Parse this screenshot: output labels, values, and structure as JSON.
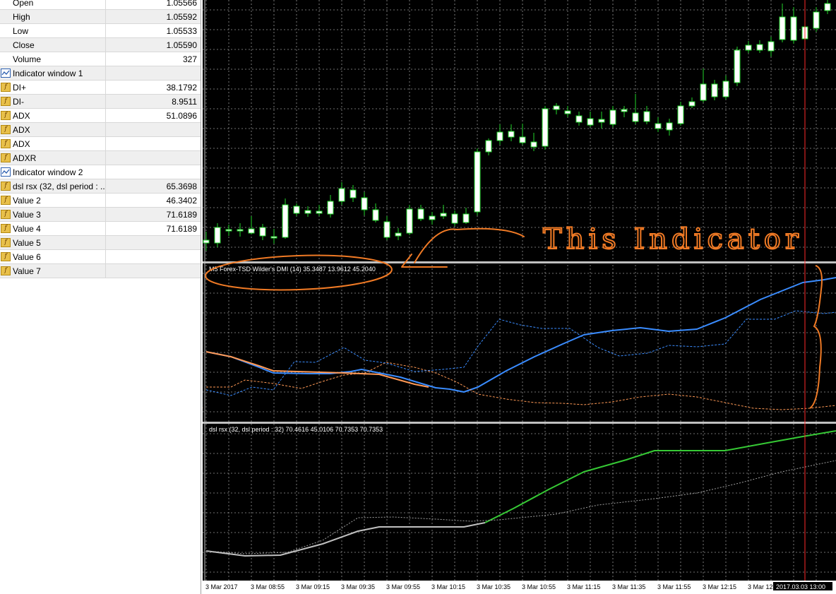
{
  "data_window": {
    "rows": [
      {
        "name": "Open",
        "value": "1.05566",
        "icon": "none",
        "alt": false
      },
      {
        "name": "High",
        "value": "1.05592",
        "icon": "none",
        "alt": true
      },
      {
        "name": "Low",
        "value": "1.05533",
        "icon": "none",
        "alt": false
      },
      {
        "name": "Close",
        "value": "1.05590",
        "icon": "none",
        "alt": true
      },
      {
        "name": "Volume",
        "value": "327",
        "icon": "none",
        "alt": false
      },
      {
        "name": "Indicator window 1",
        "value": "",
        "icon": "indicator-window-icon",
        "alt": true
      },
      {
        "name": "DI+",
        "value": "38.1792",
        "icon": "function-icon",
        "alt": false
      },
      {
        "name": "DI-",
        "value": "8.9511",
        "icon": "function-icon",
        "alt": true
      },
      {
        "name": "ADX",
        "value": "51.0896",
        "icon": "function-icon",
        "alt": false
      },
      {
        "name": "ADX",
        "value": "",
        "icon": "function-icon",
        "alt": true
      },
      {
        "name": "ADX",
        "value": "",
        "icon": "function-icon",
        "alt": false
      },
      {
        "name": "ADXR",
        "value": "",
        "icon": "function-icon",
        "alt": true
      },
      {
        "name": "Indicator window 2",
        "value": "",
        "icon": "indicator-window-icon",
        "alt": false
      },
      {
        "name": "dsl rsx (32, dsl period : ...",
        "value": "65.3698",
        "icon": "function-icon",
        "alt": true
      },
      {
        "name": "Value 2",
        "value": "46.3402",
        "icon": "function-icon",
        "alt": false
      },
      {
        "name": "Value 3",
        "value": "71.6189",
        "icon": "function-icon",
        "alt": true
      },
      {
        "name": "Value 4",
        "value": "71.6189",
        "icon": "function-icon",
        "alt": false
      },
      {
        "name": "Value 5",
        "value": "",
        "icon": "function-icon",
        "alt": true
      },
      {
        "name": "Value 6",
        "value": "",
        "icon": "function-icon",
        "alt": false
      },
      {
        "name": "Value 7",
        "value": "",
        "icon": "function-icon",
        "alt": true
      }
    ]
  },
  "chart": {
    "dmi_label": "M5 Forex-TSD Wilder's DMI (14) 35.3487 13.9612 45.2040",
    "rsx_label": "dsl rsx (32, dsl period : 32) 70.4616 45.0106 70.7353 70.7353",
    "time_labels": [
      "3 Mar 2017",
      "3 Mar 08:55",
      "3 Mar 09:15",
      "3 Mar 09:35",
      "3 Mar 09:55",
      "3 Mar 10:15",
      "3 Mar 10:35",
      "3 Mar 10:55",
      "3 Mar 11:15",
      "3 Mar 11:35",
      "3 Mar 11:55",
      "3 Mar 12:15",
      "3 Mar 12:"
    ],
    "cursor_time": "2017.03.03 13:00",
    "annotation": "This Indicator",
    "colors": {
      "background": "#000000",
      "grid": "#c8c8c8",
      "candle_up": "#000000",
      "candle_down": "#ffffff",
      "wick": "#22d42a",
      "adx_line": "#3a8cff",
      "di_minus": "#ff9955",
      "di_plus": "#3a8cff",
      "rsx_up": "#36c935",
      "rsx_flat": "#c0c0c0",
      "cursor": "#ff2a2a",
      "annotation": "#f07a25"
    }
  }
}
